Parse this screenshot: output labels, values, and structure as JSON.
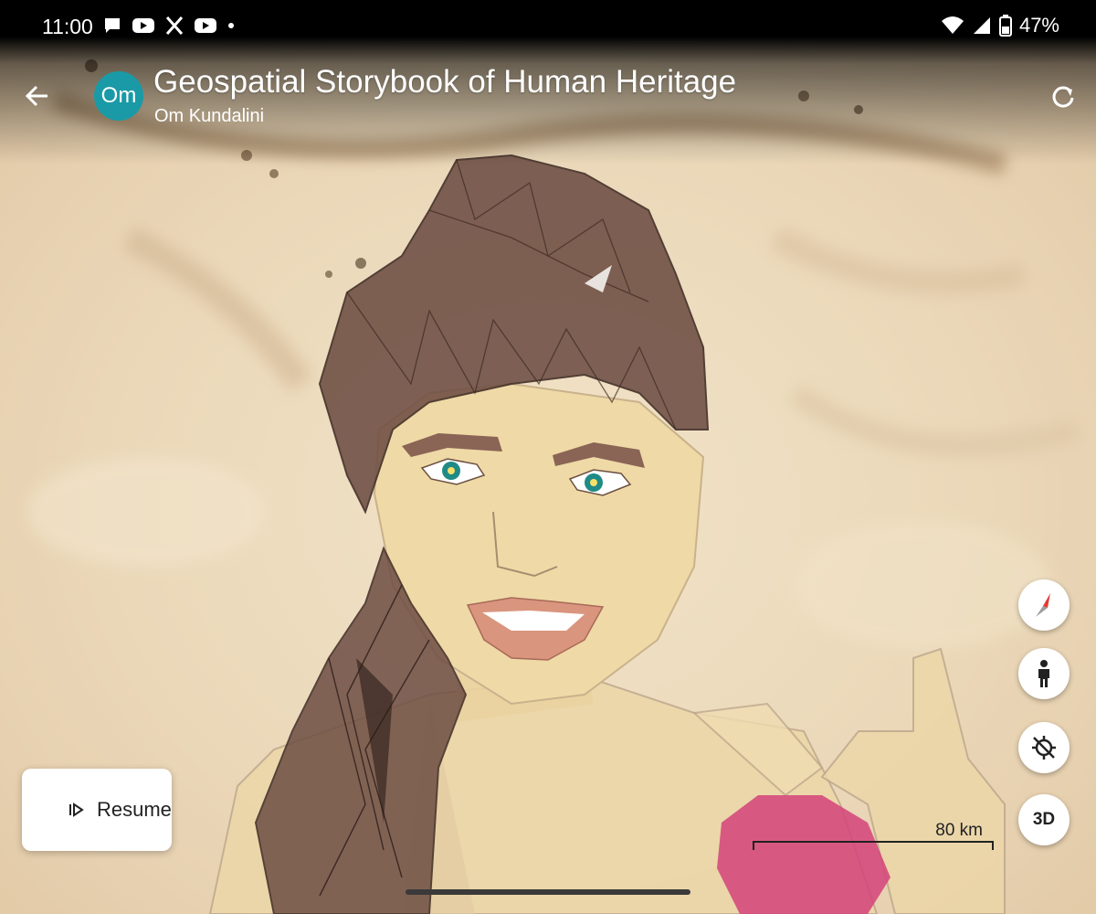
{
  "status_bar": {
    "time": "11:00",
    "battery": "47%",
    "notification_icons": [
      "chat-icon",
      "youtube-icon",
      "x-icon",
      "youtube-icon",
      "dot-icon"
    ],
    "system_icons": [
      "wifi-icon",
      "signal-icon",
      "battery-icon"
    ]
  },
  "header": {
    "avatar_text": "Om",
    "title": "Geospatial Storybook of Human Heritage",
    "author": "Om Kundalini"
  },
  "controls": {
    "compass": "compass-icon",
    "street_view": "pegman-icon",
    "location": "location-off-icon",
    "view_3d": "3D"
  },
  "resume_button": {
    "label": "Resume"
  },
  "scale_bar": {
    "label": "80 km"
  },
  "colors": {
    "avatar": "#1a9aa6",
    "map_sand": "#e9d8bc",
    "hair": "#6e4e44",
    "skin": "#ecd7a8"
  }
}
